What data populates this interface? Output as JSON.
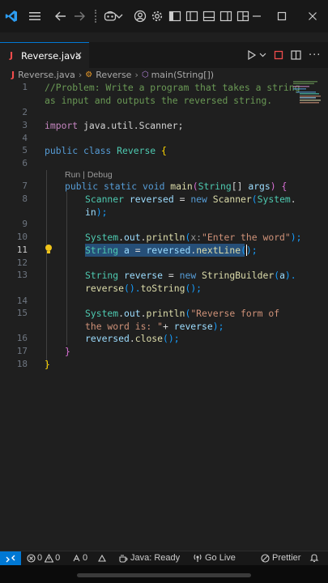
{
  "titlebar": {
    "icons": [
      "vscode-logo",
      "menu-icon",
      "back-arrow-icon",
      "forward-arrow-icon",
      "copilot-icon",
      "chevron-down-icon",
      "account-icon",
      "gear-icon",
      "toggle-primary-sidebar-icon",
      "toggle-panel-icon",
      "toggle-secondary-sidebar-icon",
      "customize-layout-icon",
      "minimize-icon",
      "maximize-icon",
      "close-icon"
    ]
  },
  "tab": {
    "file_icon": "J",
    "label": "Reverse.java",
    "close": "×"
  },
  "breadcrumb": {
    "file_icon": "J",
    "file": "Reverse.java",
    "separator": "›",
    "class": "Reverse",
    "method": "main(String[])"
  },
  "editor": {
    "codelens": "Run | Debug",
    "active_line": "11",
    "line_numbers": [
      "1",
      "2",
      "3",
      "4",
      "5",
      "6",
      "7",
      "8",
      "9",
      "10",
      "11",
      "12",
      "13",
      "14",
      "15",
      "16",
      "17",
      "18"
    ],
    "code": {
      "l1a": "//Problem: Write a program that takes a string",
      "l1b": "as input and outputs the reversed string.",
      "l3_kw": "import",
      "l3_rest": " java.util.Scanner;",
      "l5_kw": "public class",
      "l5_name": " Reverse ",
      "l5_brace": "{",
      "l7_kw": "public static void",
      "l7_fn": " main",
      "l7_p1": "(",
      "l7_type": "String",
      "l7_p2": "[] ",
      "l7_var": "args",
      "l7_p3": ") ",
      "l7_brace": "{",
      "l8_type": "Scanner",
      "l8_var": " reversed",
      "l8_eq": " = ",
      "l8_new": "new",
      "l8_fn": " Scanner",
      "l8_p": "(",
      "l8_sys": "System",
      "l8_dot": ".",
      "l8b_in": "in",
      "l8b_end": ");",
      "l10_sys": "System",
      "l10_d1": ".",
      "l10_out": "out",
      "l10_d2": ".",
      "l10_fn": "println",
      "l10_p": "(",
      "l10_hint": "x:",
      "l10_str": "\"Enter the word\"",
      "l10_end": ");",
      "l11_type": "String",
      "l11_var": " a",
      "l11_eq": " = ",
      "l11_obj": "reversed",
      "l11_dot": ".",
      "l11_fn": "nextLine",
      "l11_end": "();",
      "l13_type": "String",
      "l13_var": " reverse",
      "l13_eq": " = ",
      "l13_new": "new",
      "l13_fn": " StringBuilder",
      "l13_p": "(",
      "l13_a": "a",
      "l13_end": ").",
      "l13b_fn1": "reverse",
      "l13b_p": "().",
      "l13b_fn2": "toString",
      "l13b_end": "();",
      "l15_sys": "System",
      "l15_d1": ".",
      "l15_out": "out",
      "l15_d2": ".",
      "l15_fn": "println",
      "l15_p": "(",
      "l15_str": "\"Reverse form of",
      "l15b_str": "the word is: \"",
      "l15b_plus": "+ ",
      "l15b_var": "reverse",
      "l15b_end": ");",
      "l16_obj": "reversed",
      "l16_dot": ".",
      "l16_fn": "close",
      "l16_end": "();",
      "l17_brace": "}",
      "l18_brace": "}"
    }
  },
  "statusbar": {
    "remote_icon": "><",
    "errors": "0",
    "warnings": "0",
    "ports": "0",
    "java_status": "Java: Ready",
    "golive": "Go Live",
    "prettier": "Prettier"
  },
  "colors": {
    "accent": "#0078d4",
    "background": "#1f1f1f",
    "titlebar": "#181818",
    "selection": "#264f78"
  }
}
